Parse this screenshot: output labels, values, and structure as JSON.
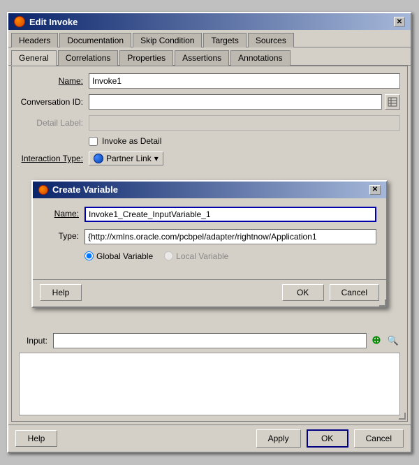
{
  "mainWindow": {
    "title": "Edit Invoke",
    "tabs_row1": [
      {
        "label": "Headers",
        "active": false
      },
      {
        "label": "Documentation",
        "active": false
      },
      {
        "label": "Skip Condition",
        "active": false
      },
      {
        "label": "Targets",
        "active": false
      },
      {
        "label": "Sources",
        "active": false
      }
    ],
    "tabs_row2": [
      {
        "label": "General",
        "active": true
      },
      {
        "label": "Correlations",
        "active": false
      },
      {
        "label": "Properties",
        "active": false
      },
      {
        "label": "Assertions",
        "active": false
      },
      {
        "label": "Annotations",
        "active": false
      }
    ],
    "form": {
      "name_label": "Name:",
      "name_value": "Invoke1",
      "conv_id_label": "Conversation ID:",
      "conv_id_value": "",
      "detail_label_text": "Detail Label:",
      "detail_label_value": "",
      "invoke_as_detail": "Invoke as Detail",
      "interaction_type_label": "Interaction Type:",
      "partner_link_btn": "Partner Link",
      "input_label": "Input:",
      "input_value": ""
    },
    "bottomBar": {
      "help_label": "Help",
      "apply_label": "Apply",
      "ok_label": "OK",
      "cancel_label": "Cancel"
    }
  },
  "modal": {
    "title": "Create Variable",
    "name_label": "Name:",
    "name_value": "Invoke1_Create_InputVariable_1",
    "type_label": "Type:",
    "type_value": "{http://xmlns.oracle.com/pcbpel/adapter/rightnow/Application1",
    "global_variable": "Global Variable",
    "local_variable": "Local Variable",
    "help_label": "Help",
    "ok_label": "OK",
    "cancel_label": "Cancel"
  }
}
